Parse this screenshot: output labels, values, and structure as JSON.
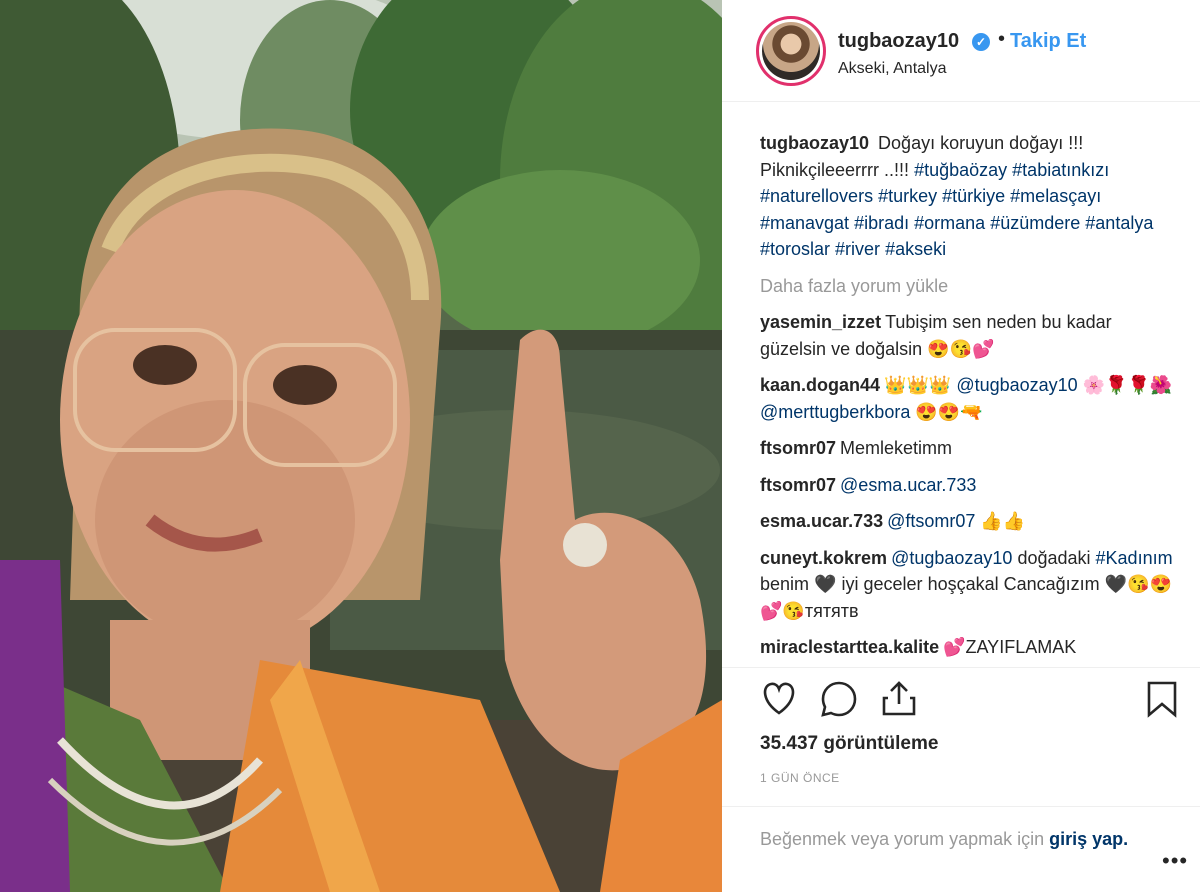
{
  "header": {
    "username": "tugbaozay10",
    "verified_icon": "verified-badge-icon",
    "separator": "•",
    "follow_label": "Takip Et",
    "location": "Akseki, Antalya"
  },
  "caption": {
    "username": "tugbaozay10",
    "text": "Doğayı koruyun doğayı !!! Piknikçileeerrrr ..!!! #tuğbaözay #tabiatınkızı #naturellovers #turkey #türkiye #melasçayı #manavgat #ibradı #ormana #üzümdere #antalya #toroslar #river #akseki"
  },
  "load_more_label": "Daha fazla yorum yükle",
  "comments": [
    {
      "user": "yasemin_izzet",
      "text": "Tubişim sen neden bu kadar güzelsin ve doğalsin 😍😘💕"
    },
    {
      "user": "kaan.dogan44",
      "text": "👑👑👑 @tugbaozay10 🌸🌹🌹🌺 @merttugberkbora 😍😍🔫"
    },
    {
      "user": "ftsomr07",
      "text": "Memleketimm"
    },
    {
      "user": "ftsomr07",
      "text": "@esma.ucar.733"
    },
    {
      "user": "esma.ucar.733",
      "text": "@ftsomr07 👍👍"
    },
    {
      "user": "cuneyt.kokrem",
      "text": "@tugbaozay10 doğadaki #Kadınım benim 🖤 iyi geceler hoşçakal Cancağızım 🖤😘😍💕😘тятятв"
    },
    {
      "user": "miraclestarttea.kalite",
      "text": "💕ZAYIFLAMAK"
    }
  ],
  "actions": {
    "like_icon": "heart-icon",
    "comment_icon": "comment-icon",
    "share_icon": "share-icon",
    "save_icon": "bookmark-icon"
  },
  "views": "35.437 görüntüleme",
  "time_ago": "1 GÜN ÖNCE",
  "login": {
    "text": "Beğenmek veya yorum yapmak için",
    "link": "giriş yap."
  },
  "more_icon": "more-options-icon",
  "more_glyph": "•••",
  "colors": {
    "link_blue": "#3897f0",
    "tag_blue": "#003569",
    "muted_gray": "#999999",
    "text": "#262626",
    "ring_pink": "#e1306c"
  }
}
